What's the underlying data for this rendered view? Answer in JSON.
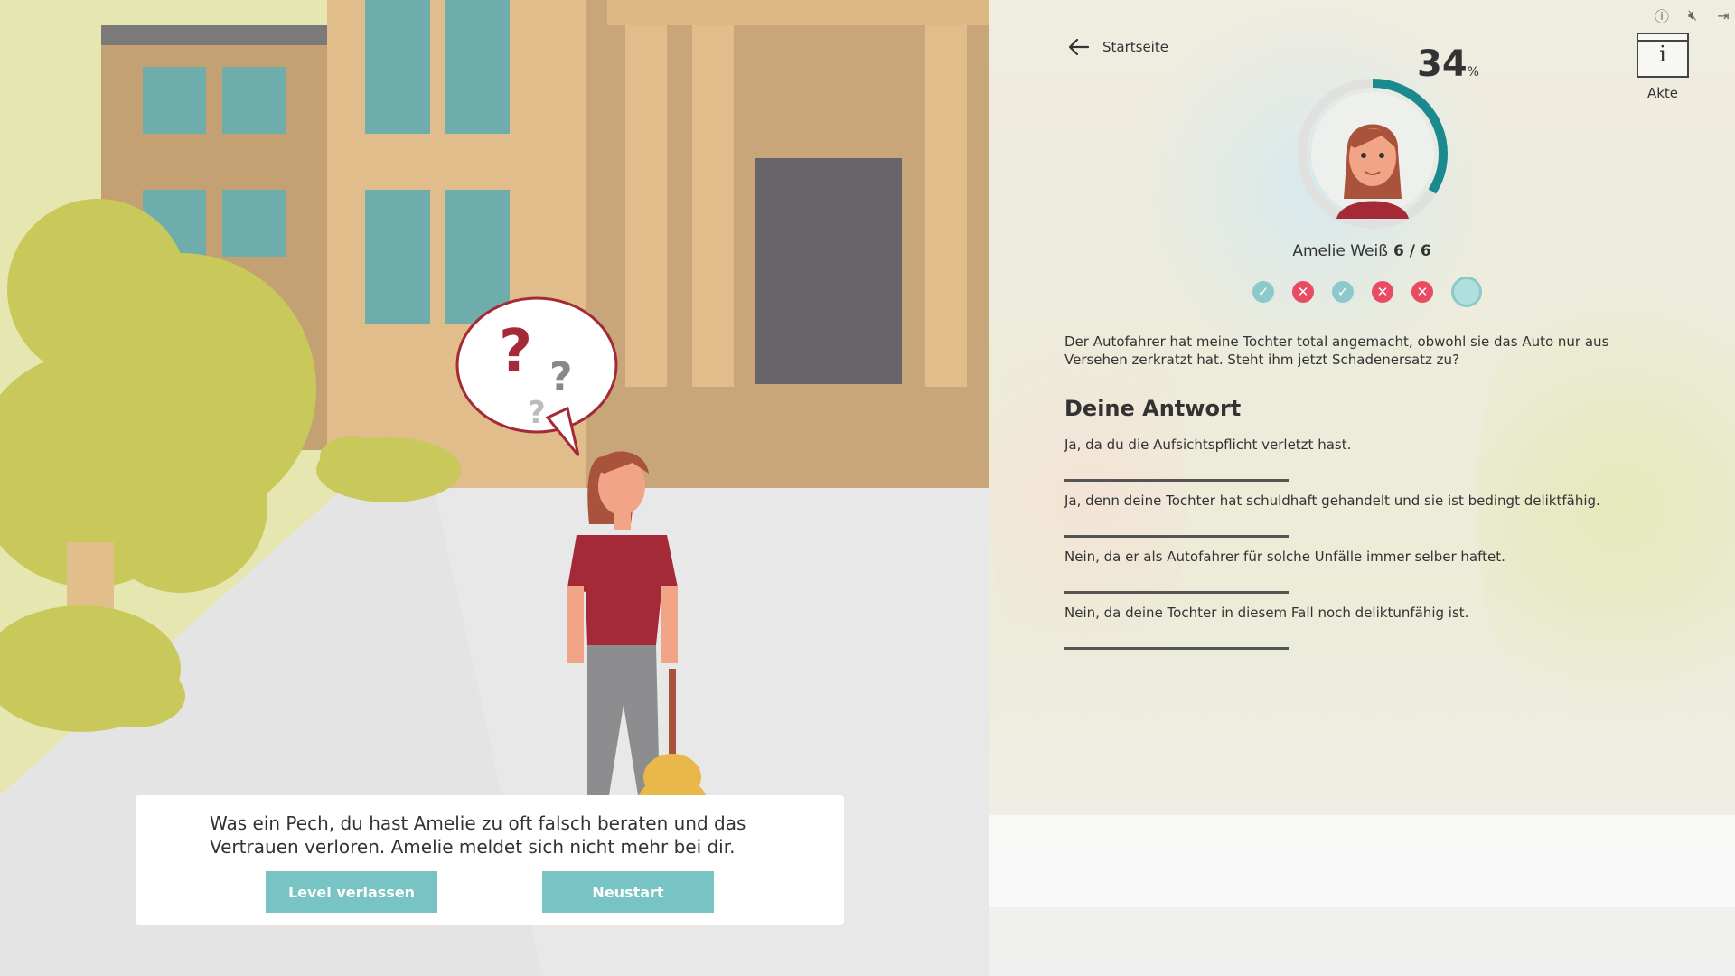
{
  "header": {
    "back_label": "Startseite",
    "akte_label": "Akte",
    "akte_icon_letter": "i"
  },
  "top_icons": [
    "info-icon",
    "mute-icon",
    "exit-icon"
  ],
  "progress": {
    "percent": "34",
    "percent_unit": "%",
    "fraction": 0.34
  },
  "character": {
    "name": "Amelie Weiß",
    "count": "6 / 6"
  },
  "results": [
    "correct",
    "wrong",
    "correct",
    "wrong",
    "wrong",
    "current"
  ],
  "question": "Der Autofahrer hat meine Tochter total angemacht, obwohl sie das Auto nur aus Versehen zerkratzt hat. Steht ihm jetzt Schadenersatz zu?",
  "answer_title": "Deine Antwort",
  "answers": [
    "Ja, da du die Aufsichtspflicht verletzt hast.",
    "Ja, denn deine Tochter hat schuldhaft gehandelt und sie ist bedingt deliktfähig.",
    "Nein, da er als Autofahrer für solche Unfälle immer selber haftet.",
    "Nein, da deine Tochter in diesem Fall noch deliktunfähig ist."
  ],
  "dialog": {
    "message": "Was ein Pech, du hast Amelie zu oft falsch beraten und das Vertrauen verloren. Amelie meldet sich nicht mehr bei dir.",
    "leave_label": "Level verlassen",
    "restart_label": "Neustart"
  },
  "colors": {
    "teal": "#78c3c4",
    "wrong": "#e94b62",
    "correct": "#8cc9cb",
    "ring": "#1a8a8e"
  }
}
